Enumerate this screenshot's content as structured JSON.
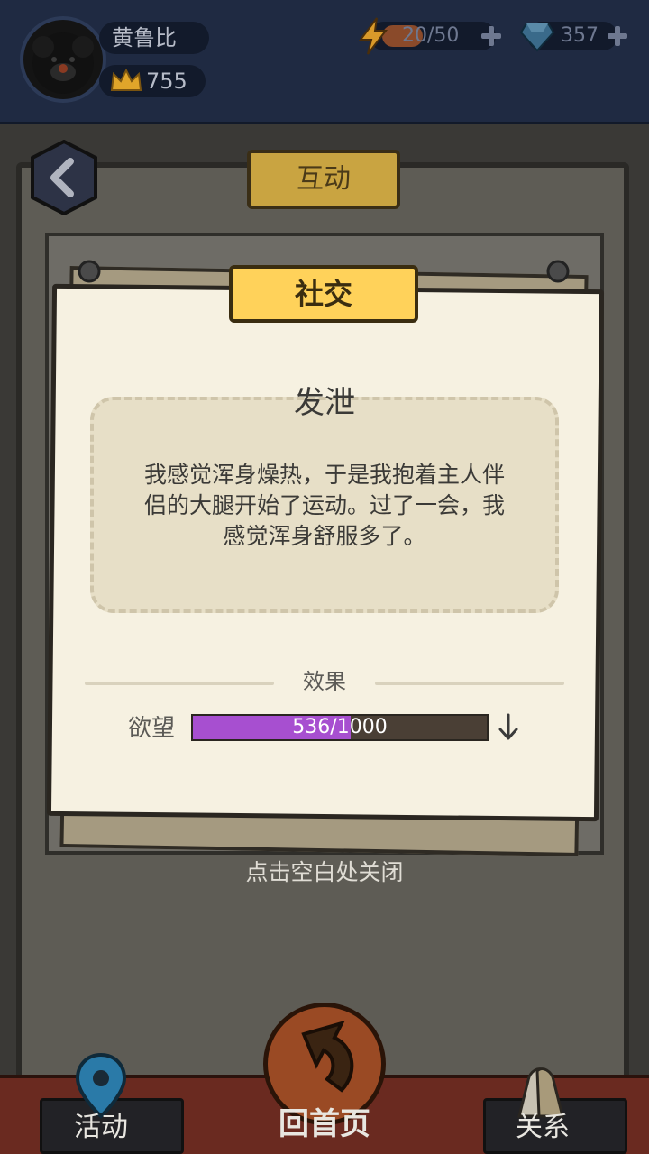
{
  "player": {
    "name": "黄鲁比",
    "crown_value": "755",
    "crown_icon": "crown-icon",
    "avatar_icon": "black-dog-avatar"
  },
  "resources": {
    "energy_text": "20/50",
    "energy_fraction": 0.4,
    "energy_icon": "lightning-icon",
    "gems_text": "357",
    "gem_icon": "diamond-icon"
  },
  "header": {
    "title": "互动",
    "back_icon": "chevron-left-icon"
  },
  "dialog": {
    "category": "社交",
    "event_title": "发泄",
    "event_body": "我感觉浑身燥热，于是我抱着主人伴侣的大腿开始了运动。过了一会，我感觉浑身舒服多了。",
    "effect_heading": "效果",
    "effect": {
      "stat_name": "欲望",
      "value_text": "536/1000",
      "current": 536,
      "max": 1000,
      "direction_icon": "arrow-down-icon",
      "fill_color": "#a74fd0"
    },
    "close_hint": "点击空白处关闭"
  },
  "nav": {
    "left_label": "活动",
    "left_icon": "map-pin-icon",
    "center_label": "回首页",
    "center_icon": "return-arrow-icon",
    "right_label": "关系",
    "right_icon": "hands-icon"
  },
  "colors": {
    "topbar": "#1f2a42",
    "card": "#f6f1e1",
    "label_yellow": "#ffd25a",
    "nav_red": "#6a2a20"
  }
}
